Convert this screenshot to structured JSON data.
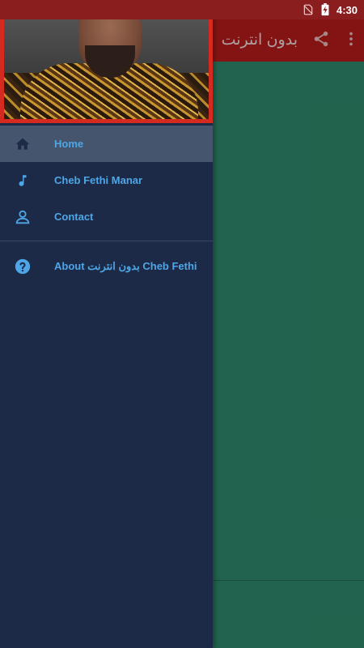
{
  "status_bar": {
    "time": "4:30",
    "icons": [
      "no-sim-icon",
      "battery-charging-icon"
    ]
  },
  "app_bar": {
    "title": "بدون انترنت",
    "actions": [
      "share-icon",
      "more-vert-icon"
    ],
    "color": "#b71c1c"
  },
  "drawer": {
    "header_image": "artist-photo",
    "items": [
      {
        "label": "Home",
        "icon": "home-icon",
        "active": true
      },
      {
        "label": "Cheb Fethi Manar",
        "icon": "music-note-icon",
        "active": false
      },
      {
        "label": "Contact",
        "icon": "person-icon",
        "active": false
      }
    ],
    "about": {
      "label": "About بدون انترنت Cheb Fethi",
      "icon": "help-icon"
    },
    "accent": "#4fa6e6",
    "background": "#1c2a47"
  }
}
